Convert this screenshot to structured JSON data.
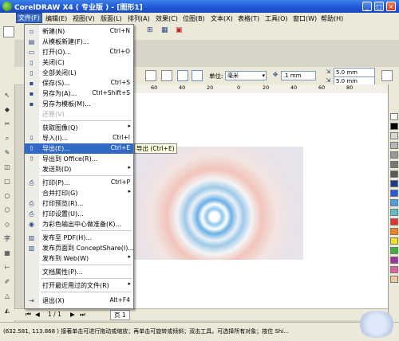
{
  "title": "CorelDRAW X4 ( 专业版 ) - [图形1]",
  "window_buttons": {
    "minimize": "_",
    "maximize": "□",
    "close": "×"
  },
  "menubar": [
    "文件(F)",
    "编辑(E)",
    "视图(V)",
    "版面(L)",
    "排列(A)",
    "效果(C)",
    "位图(B)",
    "文本(X)",
    "表格(T)",
    "工具(O)",
    "窗口(W)",
    "帮助(H)"
  ],
  "file_menu": {
    "items": [
      {
        "label": "新建(N)",
        "shortcut": "Ctrl+N",
        "icon": "new-icon"
      },
      {
        "label": "从模板新建(F)...",
        "shortcut": "",
        "icon": "template-icon"
      },
      {
        "label": "打开(O)...",
        "shortcut": "Ctrl+O",
        "icon": "open-icon"
      },
      {
        "label": "关闭(C)",
        "shortcut": "",
        "icon": "close-doc-icon"
      },
      {
        "label": "全部关闭(L)",
        "shortcut": "",
        "icon": "close-all-icon"
      },
      {
        "label": "保存(S)...",
        "shortcut": "Ctrl+S",
        "icon": "save-icon"
      },
      {
        "label": "另存为(A)...",
        "shortcut": "Ctrl+Shift+S",
        "icon": "save-as-icon"
      },
      {
        "label": "另存为模板(M)...",
        "shortcut": "",
        "icon": "save-template-icon"
      },
      {
        "label": "还原(V)",
        "shortcut": "",
        "icon": "",
        "disabled": true
      },
      {
        "label": "获取图像(Q)",
        "shortcut": "",
        "submenu": true
      },
      {
        "label": "导入(I)...",
        "shortcut": "Ctrl+I",
        "icon": "import-icon"
      },
      {
        "label": "导出(E)...",
        "shortcut": "Ctrl+E",
        "icon": "export-icon",
        "highlighted": true
      },
      {
        "label": "导出到 Office(R)...",
        "shortcut": "",
        "icon": "office-export-icon"
      },
      {
        "label": "发送到(D)",
        "shortcut": "",
        "submenu": true
      },
      {
        "label": "打印(P)...",
        "shortcut": "Ctrl+P",
        "icon": "print-icon"
      },
      {
        "label": "合并打印(G)",
        "shortcut": "",
        "submenu": true
      },
      {
        "label": "打印预览(R)...",
        "shortcut": "",
        "icon": "print-preview-icon"
      },
      {
        "label": "打印设置(U)...",
        "shortcut": "",
        "icon": "print-setup-icon"
      },
      {
        "label": "为彩色输出中心做准备(K)...",
        "shortcut": "",
        "icon": "prepare-output-icon"
      },
      {
        "label": "发布至 PDF(H)...",
        "shortcut": "",
        "icon": "pdf-icon"
      },
      {
        "label": "发布页面到 ConceptShare(I)...",
        "shortcut": "",
        "icon": "conceptshare-icon"
      },
      {
        "label": "发布到 Web(W)",
        "shortcut": "",
        "submenu": true
      },
      {
        "label": "文档属性(P)...",
        "shortcut": "",
        "icon": ""
      },
      {
        "label": "打开最近用过的文件(R)",
        "shortcut": "",
        "submenu": true
      },
      {
        "label": "退出(X)",
        "shortcut": "Alt+F4",
        "icon": "exit-icon"
      }
    ]
  },
  "tooltip": "导出 (Ctrl+E)",
  "property_bar": {
    "units_label": "单位:",
    "units_value": "毫米",
    "nudge_value": ".1 mm",
    "dup_x": "5.0 mm",
    "dup_y": "5.0 mm"
  },
  "ruler_numbers": [
    "60",
    "40",
    "20",
    "0",
    "20",
    "40",
    "60",
    "80"
  ],
  "page_nav": {
    "counter": "1 / 1",
    "tab": "页 1"
  },
  "status": "(632.581, 113.868 )   接著单击可进行拖动或缩放；再单击可旋转或倾斜；双击工具，可选择所有对象；按住 Shi...",
  "palette_colors": [
    "#ffffff",
    "#000000",
    "#d8d8d8",
    "#b8b8b8",
    "#989898",
    "#787878",
    "#585858",
    "#1e3a8a",
    "#2858d8",
    "#4aa0e8",
    "#58c0c8",
    "#e83030",
    "#f08020",
    "#f0e020",
    "#40b040",
    "#a030a0",
    "#e060a0",
    "#f0c8a0"
  ]
}
